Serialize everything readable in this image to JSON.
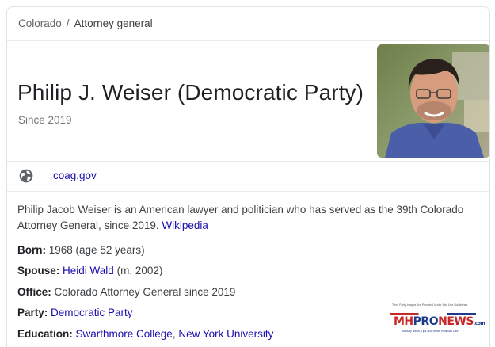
{
  "breadcrumb": {
    "parent": "Colorado",
    "separator": "/",
    "current": "Attorney general"
  },
  "header": {
    "title": "Philip J. Weiser (Democratic Party)",
    "subtitle": "Since 2019"
  },
  "website": {
    "icon": "globe-icon",
    "label": "coag.gov"
  },
  "description": {
    "text": "Philip Jacob Weiser is an American lawyer and politician who has served as the 39th Colorado Attorney General, since 2019.",
    "source": "Wikipedia"
  },
  "facts": {
    "born": {
      "label": "Born:",
      "value": "1968 (age 52 years)"
    },
    "spouse": {
      "label": "Spouse:",
      "link": "Heidi Wald",
      "suffix": "(m. 2002)"
    },
    "office": {
      "label": "Office:",
      "value": "Colorado Attorney General since 2019"
    },
    "party": {
      "label": "Party:",
      "link": "Democratic Party"
    },
    "education": {
      "label": "Education:",
      "links": [
        "Swarthmore College",
        "New York University"
      ],
      "separator": ", "
    }
  },
  "watermark": {
    "disclaimer": "Third Party Images Are Provided Under Fair Use Guidelines",
    "brand_mh": "MH",
    "brand_pro": "PRO",
    "brand_news": "NEWS",
    "brand_com": ".com",
    "tagline": "Industry News, Tips and Views Pros can Use"
  },
  "colors": {
    "link": "#1a0dab",
    "text": "#3c4043",
    "muted": "#70757a",
    "border": "#dfe1e5"
  }
}
